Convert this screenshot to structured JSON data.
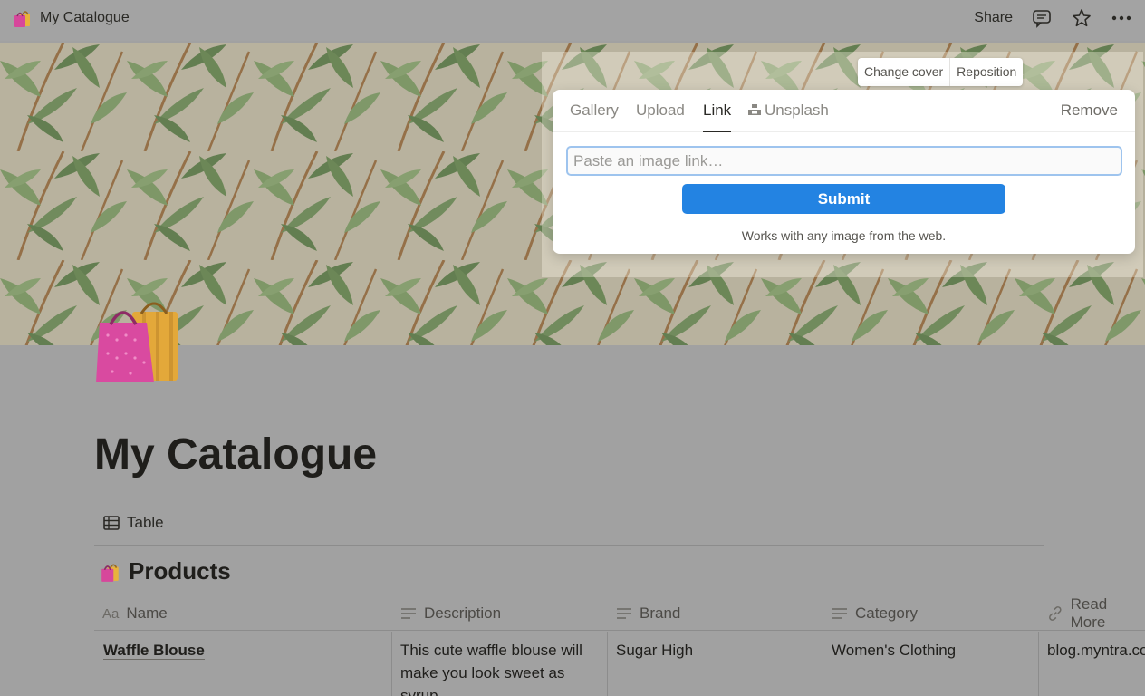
{
  "topbar": {
    "title": "My Catalogue",
    "share_label": "Share",
    "icons": [
      "comments-icon",
      "star-icon",
      "more-icon"
    ]
  },
  "cover": {
    "change_cover_label": "Change cover",
    "reposition_label": "Reposition"
  },
  "popup": {
    "tabs": [
      {
        "label": "Gallery"
      },
      {
        "label": "Upload"
      },
      {
        "label": "Link"
      },
      {
        "label": "Unsplash"
      }
    ],
    "active_tab": "Link",
    "remove_label": "Remove",
    "input_placeholder": "Paste an image link…",
    "input_value": "",
    "submit_label": "Submit",
    "hint": "Works with any image from the web."
  },
  "page": {
    "title": "My Catalogue",
    "view_label": "Table",
    "database_title": "Products"
  },
  "table": {
    "columns": [
      {
        "label": "Name",
        "icon": "title-icon"
      },
      {
        "label": "Description",
        "icon": "text-icon"
      },
      {
        "label": "Brand",
        "icon": "text-icon"
      },
      {
        "label": "Category",
        "icon": "text-icon"
      },
      {
        "label": "Read More",
        "icon": "link-icon"
      }
    ],
    "rows": [
      {
        "name": "Waffle Blouse",
        "description": "This cute waffle blouse will make you look sweet as syrup.",
        "brand": "Sugar High",
        "category": "Women's Clothing",
        "read_more": "blog.myntra.com"
      }
    ]
  },
  "colors": {
    "accent": "#2383e2",
    "overlay": "#a1a1a1"
  }
}
